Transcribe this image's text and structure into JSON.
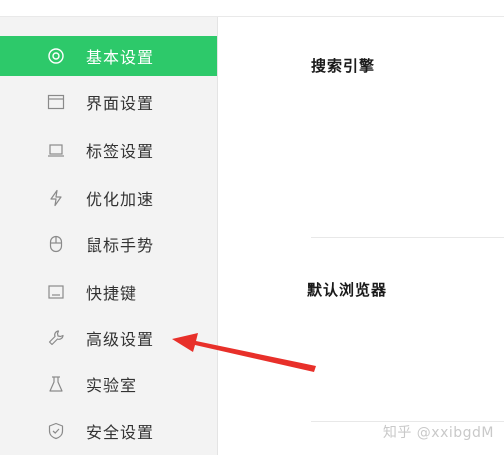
{
  "colors": {
    "accent": "#2dc96a",
    "arrow": "#e8302a"
  },
  "sidebar": {
    "items": [
      {
        "label": "基本设置",
        "icon": "target-icon",
        "active": true
      },
      {
        "label": "界面设置",
        "icon": "window-icon",
        "active": false
      },
      {
        "label": "标签设置",
        "icon": "tab-icon",
        "active": false
      },
      {
        "label": "优化加速",
        "icon": "lightning-icon",
        "active": false
      },
      {
        "label": "鼠标手势",
        "icon": "mouse-icon",
        "active": false
      },
      {
        "label": "快捷键",
        "icon": "keyboard-icon",
        "active": false
      },
      {
        "label": "高级设置",
        "icon": "wrench-icon",
        "active": false
      },
      {
        "label": "实验室",
        "icon": "flask-icon",
        "active": false
      },
      {
        "label": "安全设置",
        "icon": "shield-icon",
        "active": false
      }
    ]
  },
  "main": {
    "sections": [
      {
        "title": "搜索引擎"
      },
      {
        "title": "默认浏览器"
      }
    ]
  },
  "watermark": "知乎 @xxibgdM"
}
